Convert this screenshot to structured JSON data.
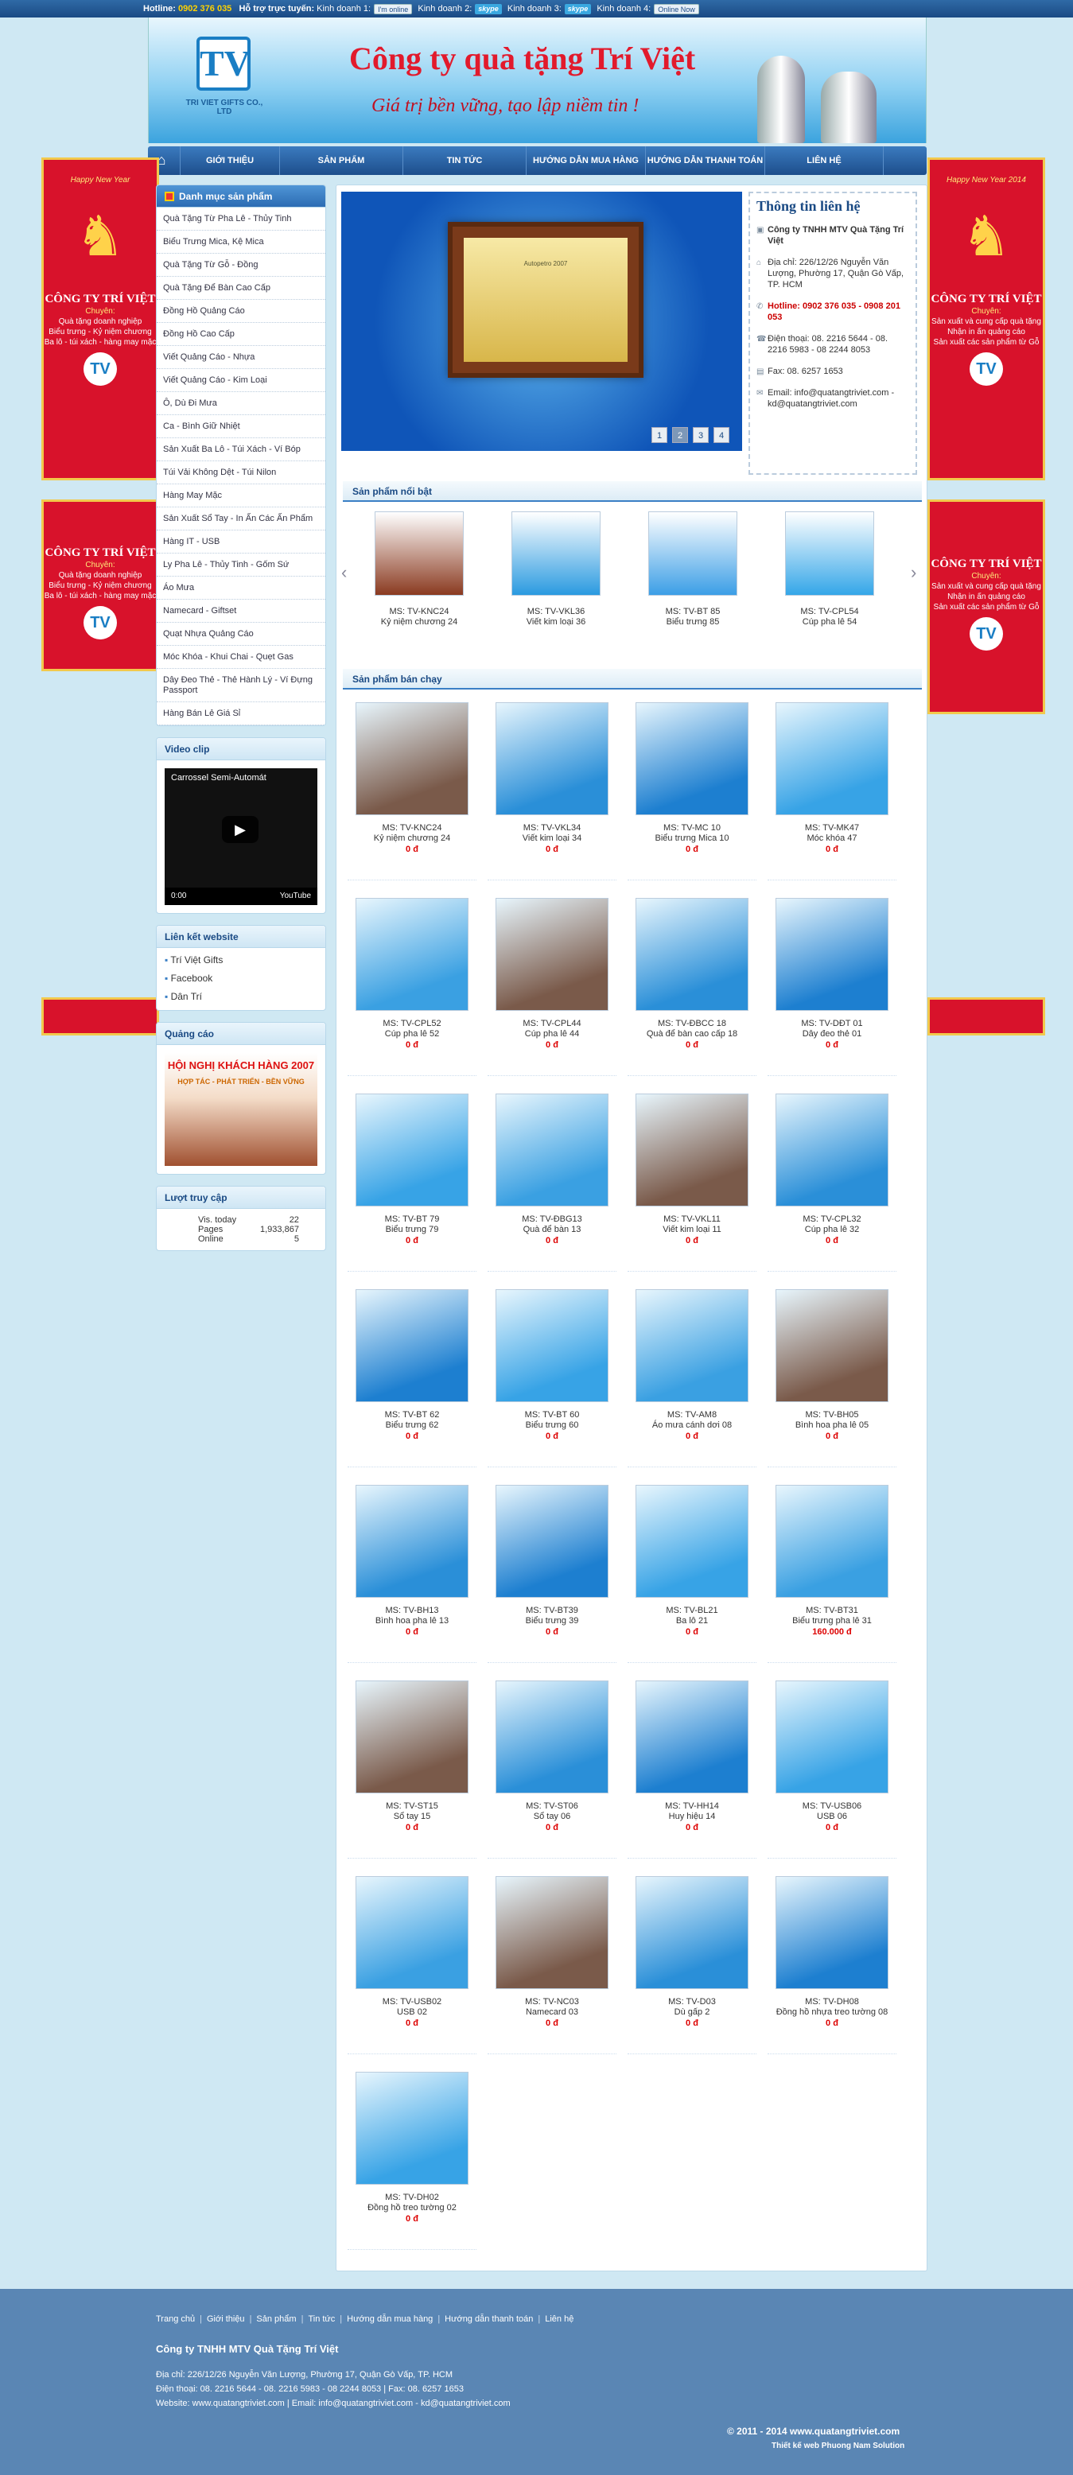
{
  "topbar": {
    "hotline_label": "Hotline:",
    "hotline": "0902 376 035",
    "support_label": "Hỗ trợ trực tuyến:",
    "kd1": "Kinh doanh 1:",
    "kd1_chip": "I'm online",
    "kd2": "Kinh doanh 2:",
    "kd2_chip": "skype",
    "kd3": "Kinh doanh 3:",
    "kd3_chip": "skype",
    "kd4": "Kinh doanh 4:",
    "kd4_chip": "Online Now"
  },
  "banner": {
    "logo_letters": "TV",
    "logo_caption": "TRI VIET GIFTS CO., LTD",
    "company": "Công ty quà tặng Trí Việt",
    "slogan": "Giá trị bền vững, tạo lập niềm tin !"
  },
  "nav": {
    "home_icon": "home-icon",
    "items": [
      "GIỚI THIỆU",
      "SẢN PHẨM",
      "TIN TỨC",
      "HƯỚNG DẪN MUA HÀNG",
      "HƯỚNG DẪN THANH TOÁN",
      "LIÊN HỆ"
    ]
  },
  "side_ads": {
    "new_year_left": "Happy New Year",
    "new_year_right": "Happy New Year 2014",
    "company": "CÔNG TY TRÍ VIỆT",
    "chuyen": "Chuyên:",
    "lines": [
      "Quà tặng doanh nghiệp",
      "Biểu trưng - Kỷ niệm chương",
      "Ba lô - túi xách - hàng may mặc"
    ],
    "lines_right": [
      "Sản xuất và cung cấp quà tặng",
      "Nhận in ấn quảng cáo",
      "Sản xuất các sản phẩm từ Gỗ"
    ]
  },
  "categories": {
    "title": "Danh mục sản phẩm",
    "items": [
      "Quà Tặng Từ Pha Lê - Thủy Tinh",
      "Biểu Trưng Mica, Kệ Mica",
      "Quà Tặng Từ Gỗ - Đồng",
      "Quà Tặng Để Bàn Cao Cấp",
      "Đồng Hồ Quảng Cáo",
      "Đồng Hồ Cao Cấp",
      "Viết Quảng Cáo - Nhựa",
      "Viết Quảng Cáo - Kim Loại",
      "Ô, Dù Đi Mưa",
      "Ca - Bình Giữ Nhiệt",
      "Sản Xuất Ba Lô - Túi Xách - Ví Bóp",
      "Túi Vải Không Dệt - Túi Nilon",
      "Hàng May Mặc",
      "Sản Xuất Sổ Tay - In Ấn Các Ấn Phẩm",
      "Hàng IT - USB",
      "Ly Pha Lê - Thủy Tinh - Gốm Sứ",
      "Áo Mưa",
      "Namecard - Giftset",
      "Quạt Nhựa Quảng Cáo",
      "Móc Khóa - Khui Chai - Quẹt Gas",
      "Dây Đeo Thẻ - Thẻ Hành Lý - Ví Đựng Passport",
      "Hàng Bán Lẻ Giá Sỉ"
    ]
  },
  "video": {
    "title": "Video clip",
    "caption": "Carrossel Semi-Automát",
    "time": "0:00",
    "brand": "YouTube"
  },
  "links": {
    "title": "Liên kết website",
    "items": [
      "Trí Việt Gifts",
      "Facebook",
      "Dân Trí"
    ]
  },
  "ads": {
    "title": "Quảng cáo",
    "line1": "HỘI NGHỊ KHÁCH HÀNG 2007",
    "line2": "HỢP TÁC - PHÁT TRIỂN - BỀN VỮNG"
  },
  "visits": {
    "title": "Lượt truy cập",
    "rows": [
      {
        "label": "Vis. today",
        "value": "22"
      },
      {
        "label": "Pages",
        "value": "1,933,867"
      },
      {
        "label": "Online",
        "value": "5"
      }
    ]
  },
  "slider": {
    "plaque_text": "Autopetro 2007",
    "pages": [
      "1",
      "2",
      "3",
      "4"
    ]
  },
  "contact": {
    "title": "Thông tin liên hệ",
    "company": "Công ty TNHH MTV Quà Tặng Trí Việt",
    "address": "Địa chỉ: 226/12/26 Nguyễn Văn Lượng, Phường 17, Quận Gò Vấp, TP. HCM",
    "hotline": "Hotline: 0902 376 035 - 0908 201 053",
    "phone": "Điện thoại: 08. 2216 5644 - 08. 2216 5983 - 08 2244 8053",
    "fax": "Fax: 08. 6257 1653",
    "email": "Email: info@quatangtriviet.com - kd@quatangtriviet.com"
  },
  "featured": {
    "title": "Sản phẩm nổi bật",
    "items": [
      {
        "code": "MS: TV-KNC24",
        "name": "Kỷ niệm chương 24"
      },
      {
        "code": "MS: TV-VKL36",
        "name": "Viết kim loại 36"
      },
      {
        "code": "MS: TV-BT 85",
        "name": "Biểu trưng 85"
      },
      {
        "code": "MS: TV-CPL54",
        "name": "Cúp pha lê 54"
      }
    ]
  },
  "bestsellers": {
    "title": "Sản phẩm bán chạy",
    "items": [
      {
        "code": "MS: TV-KNC24",
        "name": "Kỷ niệm chương 24",
        "price": "0 đ"
      },
      {
        "code": "MS: TV-VKL34",
        "name": "Viết kim loại 34",
        "price": "0 đ"
      },
      {
        "code": "MS: TV-MC 10",
        "name": "Biểu trưng Mica 10",
        "price": "0 đ"
      },
      {
        "code": "MS: TV-MK47",
        "name": "Móc khóa 47",
        "price": "0 đ"
      },
      {
        "code": "MS: TV-CPL52",
        "name": "Cúp pha lê 52",
        "price": "0 đ"
      },
      {
        "code": "MS: TV-CPL44",
        "name": "Cúp pha lê 44",
        "price": "0 đ"
      },
      {
        "code": "MS: TV-ĐBCC 18",
        "name": "Quà để bàn cao cấp 18",
        "price": "0 đ"
      },
      {
        "code": "MS: TV-DĐT 01",
        "name": "Dây đeo thẻ 01",
        "price": "0 đ"
      },
      {
        "code": "MS: TV-BT 79",
        "name": "Biểu trưng 79",
        "price": "0 đ"
      },
      {
        "code": "MS: TV-ĐBG13",
        "name": "Quà để bàn 13",
        "price": "0 đ"
      },
      {
        "code": "MS: TV-VKL11",
        "name": "Viết kim loại 11",
        "price": "0 đ"
      },
      {
        "code": "MS: TV-CPL32",
        "name": "Cúp pha lê 32",
        "price": "0 đ"
      },
      {
        "code": "MS: TV-BT 62",
        "name": "Biểu trưng 62",
        "price": "0 đ"
      },
      {
        "code": "MS: TV-BT 60",
        "name": "Biểu trưng 60",
        "price": "0 đ"
      },
      {
        "code": "MS: TV-AM8",
        "name": "Áo mưa cánh dơi 08",
        "price": "0 đ"
      },
      {
        "code": "MS: TV-BH05",
        "name": "Bình hoa pha lê 05",
        "price": "0 đ"
      },
      {
        "code": "MS: TV-BH13",
        "name": "Bình hoa pha lê 13",
        "price": "0 đ"
      },
      {
        "code": "MS: TV-BT39",
        "name": "Biểu trưng 39",
        "price": "0 đ"
      },
      {
        "code": "MS: TV-BL21",
        "name": "Ba lô 21",
        "price": "0 đ"
      },
      {
        "code": "MS: TV-BT31",
        "name": "Biểu trưng pha lê 31",
        "price": "160.000 đ"
      },
      {
        "code": "MS: TV-ST15",
        "name": "Sổ tay 15",
        "price": "0 đ"
      },
      {
        "code": "MS: TV-ST06",
        "name": "Sổ tay 06",
        "price": "0 đ"
      },
      {
        "code": "MS: TV-HH14",
        "name": "Huy hiệu 14",
        "price": "0 đ"
      },
      {
        "code": "MS: TV-USB06",
        "name": "USB 06",
        "price": "0 đ"
      },
      {
        "code": "MS: TV-USB02",
        "name": "USB 02",
        "price": "0 đ"
      },
      {
        "code": "MS: TV-NC03",
        "name": "Namecard 03",
        "price": "0 đ"
      },
      {
        "code": "MS: TV-D03",
        "name": "Dù gấp 2",
        "price": "0 đ"
      },
      {
        "code": "MS: TV-DH08",
        "name": "Đồng hồ nhựa treo tường 08",
        "price": "0 đ"
      },
      {
        "code": "MS: TV-DH02",
        "name": "Đồng hồ treo tường 02",
        "price": "0 đ"
      }
    ]
  },
  "footer": {
    "links": [
      "Trang chủ",
      "Giới thiệu",
      "Sản phẩm",
      "Tin tức",
      "Hướng dẫn mua hàng",
      "Hướng dẫn thanh toán",
      "Liên hệ"
    ],
    "company": "Công ty TNHH MTV Quà Tặng Trí Việt",
    "address": "Địa chỉ: 226/12/26 Nguyễn Văn Lượng, Phường 17, Quận Gò Vấp, TP. HCM",
    "phone": "Điện thoại: 08. 2216 5644 - 08. 2216 5983 - 08 2244 8053 | Fax: 08. 6257 1653",
    "web": "Website: www.quatangtriviet.com | Email: info@quatangtriviet.com - kd@quatangtriviet.com",
    "copyright": "© 2011 - 2014 www.quatangtriviet.com",
    "designer": "Thiết kế web Phuong Nam Solution"
  }
}
